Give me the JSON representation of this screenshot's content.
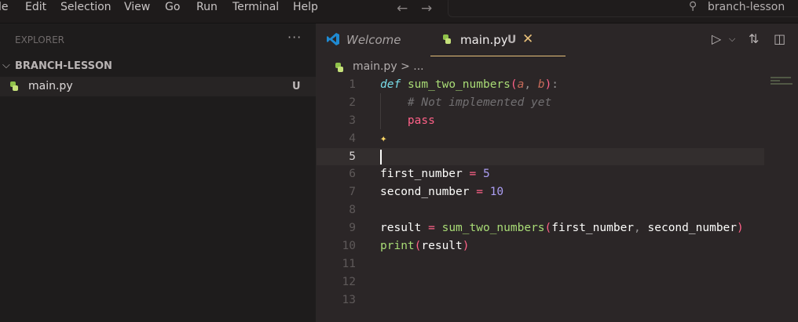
{
  "menu": [
    "le",
    "Edit",
    "Selection",
    "View",
    "Go",
    "Run",
    "Terminal",
    "Help"
  ],
  "search": {
    "text": "branch-lesson"
  },
  "sidebar": {
    "title": "EXPLORER",
    "more": "···",
    "folder": "BRANCH-LESSON",
    "file": {
      "name": "main.py",
      "status": "U"
    }
  },
  "tabs": {
    "welcome": "Welcome",
    "main": {
      "label": "main.py",
      "status": "U"
    }
  },
  "breadcrumb": {
    "file": "main.py",
    "rest": "> ..."
  },
  "code": [
    [
      [
        "def",
        "kw"
      ],
      [
        " ",
        ""
      ],
      [
        "sum_two_numbers",
        "fn"
      ],
      [
        "(",
        "pn"
      ],
      [
        "a",
        "pa"
      ],
      [
        ", ",
        "pu"
      ],
      [
        "b",
        "pa"
      ],
      [
        ")",
        "pn"
      ],
      [
        ":",
        "pu"
      ]
    ],
    [
      [
        "    ",
        ""
      ],
      [
        "# Not implemented yet",
        "cm"
      ]
    ],
    [
      [
        "    ",
        ""
      ],
      [
        "pass",
        "op"
      ]
    ],
    [],
    [],
    [
      [
        "first_number",
        ""
      ],
      [
        " = ",
        "op"
      ],
      [
        "5",
        "nu"
      ]
    ],
    [
      [
        "second_number",
        ""
      ],
      [
        " = ",
        "op"
      ],
      [
        "10",
        "nu"
      ]
    ],
    [],
    [
      [
        "result",
        ""
      ],
      [
        " = ",
        "op"
      ],
      [
        "sum_two_numbers",
        "fn"
      ],
      [
        "(",
        "pn"
      ],
      [
        "first_number",
        ""
      ],
      [
        ", ",
        "pu"
      ],
      [
        "second_number",
        ""
      ],
      [
        ")",
        "pn"
      ]
    ],
    [
      [
        "print",
        "fn"
      ],
      [
        "(",
        "pn"
      ],
      [
        "result",
        ""
      ],
      [
        ")",
        "pn"
      ]
    ],
    [],
    [],
    []
  ],
  "current_line": 5
}
